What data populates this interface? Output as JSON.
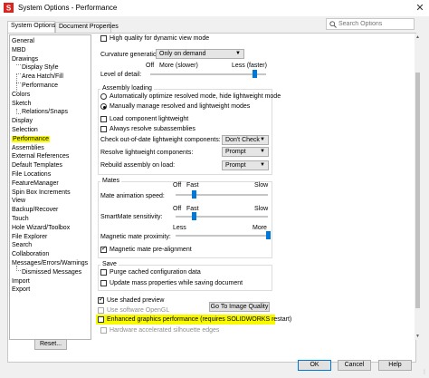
{
  "window": {
    "title": "System Options - Performance",
    "close_label": "✕"
  },
  "tabs": [
    {
      "label": "System Options",
      "active": true
    },
    {
      "label": "Document Properties",
      "active": false
    }
  ],
  "search": {
    "placeholder": "Search Options"
  },
  "tree": [
    {
      "label": "General",
      "indent": 0
    },
    {
      "label": "MBD",
      "indent": 0
    },
    {
      "label": "Drawings",
      "indent": 0
    },
    {
      "label": "Display Style",
      "indent": 1
    },
    {
      "label": "Area Hatch/Fill",
      "indent": 1
    },
    {
      "label": "Performance",
      "indent": 1
    },
    {
      "label": "Colors",
      "indent": 0
    },
    {
      "label": "Sketch",
      "indent": 0
    },
    {
      "label": "Relations/Snaps",
      "indent": 1
    },
    {
      "label": "Display",
      "indent": 0
    },
    {
      "label": "Selection",
      "indent": 0
    },
    {
      "label": "Performance",
      "indent": 0,
      "highlighted": true
    },
    {
      "label": "Assemblies",
      "indent": 0
    },
    {
      "label": "External References",
      "indent": 0
    },
    {
      "label": "Default Templates",
      "indent": 0
    },
    {
      "label": "File Locations",
      "indent": 0
    },
    {
      "label": "FeatureManager",
      "indent": 0
    },
    {
      "label": "Spin Box Increments",
      "indent": 0
    },
    {
      "label": "View",
      "indent": 0
    },
    {
      "label": "Backup/Recover",
      "indent": 0
    },
    {
      "label": "Touch",
      "indent": 0
    },
    {
      "label": "Hole Wizard/Toolbox",
      "indent": 0
    },
    {
      "label": "File Explorer",
      "indent": 0
    },
    {
      "label": "Search",
      "indent": 0
    },
    {
      "label": "Collaboration",
      "indent": 0
    },
    {
      "label": "Messages/Errors/Warnings",
      "indent": 0
    },
    {
      "label": "Dismissed Messages",
      "indent": 1
    },
    {
      "label": "Import",
      "indent": 0
    },
    {
      "label": "Export",
      "indent": 0
    }
  ],
  "reset_label": "Reset...",
  "top": {
    "high_quality_label": "High quality for dynamic view mode",
    "high_quality_checked": false,
    "curvature_label": "Curvature generation:",
    "curvature_value": "Only on demand",
    "level_of_detail_label": "Level of detail:",
    "lod_off": "Off",
    "lod_more": "More (slower)",
    "lod_less": "Less (faster)",
    "lod_level": 0.9
  },
  "assembly_loading": {
    "title": "Assembly loading",
    "radio_auto": "Automatically optimize resolved mode, hide lightweight mode",
    "radio_manual": "Manually manage resolved and lightweight modes",
    "selected": "manual",
    "load_lightweight": "Load component lightweight",
    "load_lightweight_checked": false,
    "always_resolve": "Always resolve subassemblies",
    "always_resolve_checked": false,
    "check_outdated_label": "Check out-of-date lightweight components:",
    "check_outdated_value": "Don't Check",
    "resolve_lightweight_label": "Resolve lightweight components:",
    "resolve_lightweight_value": "Prompt",
    "rebuild_label": "Rebuild assembly on load:",
    "rebuild_value": "Prompt"
  },
  "mates": {
    "title": "Mates",
    "off": "Off",
    "fast": "Fast",
    "slow": "Slow",
    "less": "Less",
    "more": "More",
    "animation_label": "Mate animation speed:",
    "animation_level": 0.2,
    "smartmate_label": "SmartMate sensitivity:",
    "smartmate_level": 0.2,
    "magnetic_label": "Magnetic mate proximity:",
    "magnetic_level": 1.0,
    "prealign_label": "Magnetic mate pre-alignment",
    "prealign_checked": true
  },
  "save": {
    "title": "Save",
    "purge_label": "Purge cached configuration data",
    "purge_checked": false,
    "update_mass_label": "Update mass properties while saving document",
    "update_mass_checked": false
  },
  "shaded": {
    "use_shaded_label": "Use shaded preview",
    "use_shaded_checked": true,
    "use_software_label": "Use software OpenGL",
    "go_to_image_quality": "Go To Image Quality",
    "enhanced_label": "Enhanced graphics performance (requires SOLIDWORKS restart)",
    "enhanced_checked": false,
    "hardware_label": "Hardware accelerated silhouette edges"
  },
  "footer": {
    "ok": "OK",
    "cancel": "Cancel",
    "help": "Help"
  },
  "colors": {
    "highlight": "#f9f900",
    "slider": "#0078d7"
  }
}
